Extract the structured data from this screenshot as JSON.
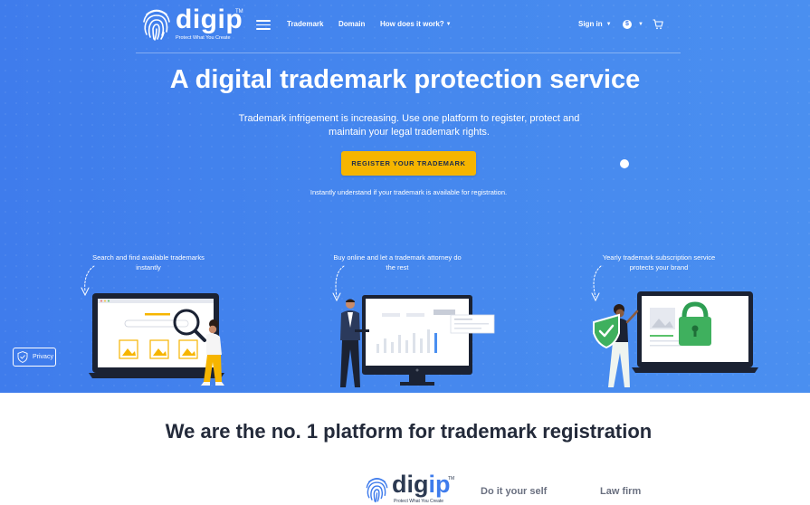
{
  "brand": {
    "name_part1": "dig",
    "name_part2": "ip",
    "tm": "TM",
    "tagline": "Protect What You Create"
  },
  "nav": {
    "items": [
      {
        "label": "Trademark"
      },
      {
        "label": "Domain"
      },
      {
        "label": "How does it work?"
      }
    ],
    "signin_label": "Sign in",
    "currency_symbol": "$"
  },
  "hero": {
    "title": "A digital trademark protection service",
    "subtitle": "Trademark infrigement is increasing. Use one platform to register, protect and maintain your legal trademark rights.",
    "cta_label": "REGISTER YOUR TRADEMARK",
    "note": "Instantly understand if your trademark is available for registration."
  },
  "features": [
    {
      "caption": "Search and find available trademarks instantly",
      "icon": "search-laptop-illustration"
    },
    {
      "caption": "Buy online and let a trademark attorney do the rest",
      "icon": "attorney-monitor-illustration"
    },
    {
      "caption": "Yearly trademark subscription service protects your brand",
      "icon": "shield-lock-illustration"
    }
  ],
  "privacy": {
    "label": "Privacy"
  },
  "comparison": {
    "title": "We are the no. 1 platform for trademark registration",
    "columns": [
      "Do it your self",
      "Law firm"
    ]
  },
  "colors": {
    "hero_bg": "#4587ee",
    "cta_bg": "#f6b500",
    "title_dark": "#232a3a"
  }
}
